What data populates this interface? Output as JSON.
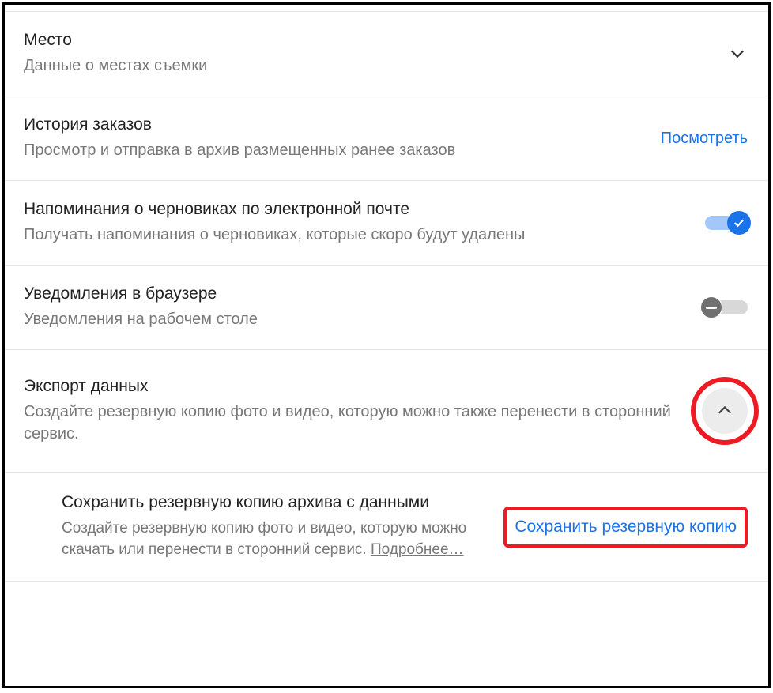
{
  "settings": {
    "place": {
      "title": "Место",
      "desc": "Данные о местах съемки"
    },
    "orderHistory": {
      "title": "История заказов",
      "desc": "Просмотр и отправка в архив размещенных ранее заказов",
      "action": "Посмотреть"
    },
    "draftReminders": {
      "title": "Напоминания о черновиках по электронной почте",
      "desc": "Получать напоминания о черновиках, которые скоро будут удалены",
      "enabled": true
    },
    "browserNotifications": {
      "title": "Уведомления в браузере",
      "desc": "Уведомления на рабочем столе",
      "enabled": false
    },
    "exportData": {
      "title": "Экспорт данных",
      "desc": "Создайте резервную копию фото и видео, которую можно также перенести в сторонний сервис.",
      "expanded": true
    },
    "backup": {
      "title": "Сохранить резервную копию архива с данными",
      "desc": "Создайте резервную копию фото и видео, которую можно скачать или перенести в сторонний сервис. ",
      "learnMore": "Подробнее…",
      "button": "Сохранить резервную копию"
    }
  }
}
